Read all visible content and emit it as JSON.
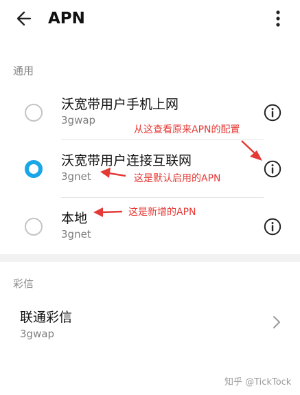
{
  "header": {
    "title": "APN"
  },
  "general": {
    "label": "通用",
    "items": [
      {
        "title": "沃宽带用户手机上网",
        "sub": "3gwap",
        "selected": false
      },
      {
        "title": "沃宽带用户连接互联网",
        "sub": "3gnet",
        "selected": true
      },
      {
        "title": "本地",
        "sub": "3gnet",
        "selected": false
      }
    ]
  },
  "mms": {
    "label": "彩信",
    "item": {
      "title": "联通彩信",
      "sub": "3gwap"
    }
  },
  "annotations": {
    "view_config": "从这查看原来APN的配置",
    "default_apn": "这是默认启用的APN",
    "new_apn": "这是新增的APN"
  },
  "watermark": "知乎 @TickTock",
  "colors": {
    "accent": "#1aa7e8",
    "annotation": "#e53935"
  },
  "icons": {
    "back": "arrow-left",
    "more": "vertical-dots",
    "info": "circled-i",
    "chevron": "chevron-right"
  }
}
